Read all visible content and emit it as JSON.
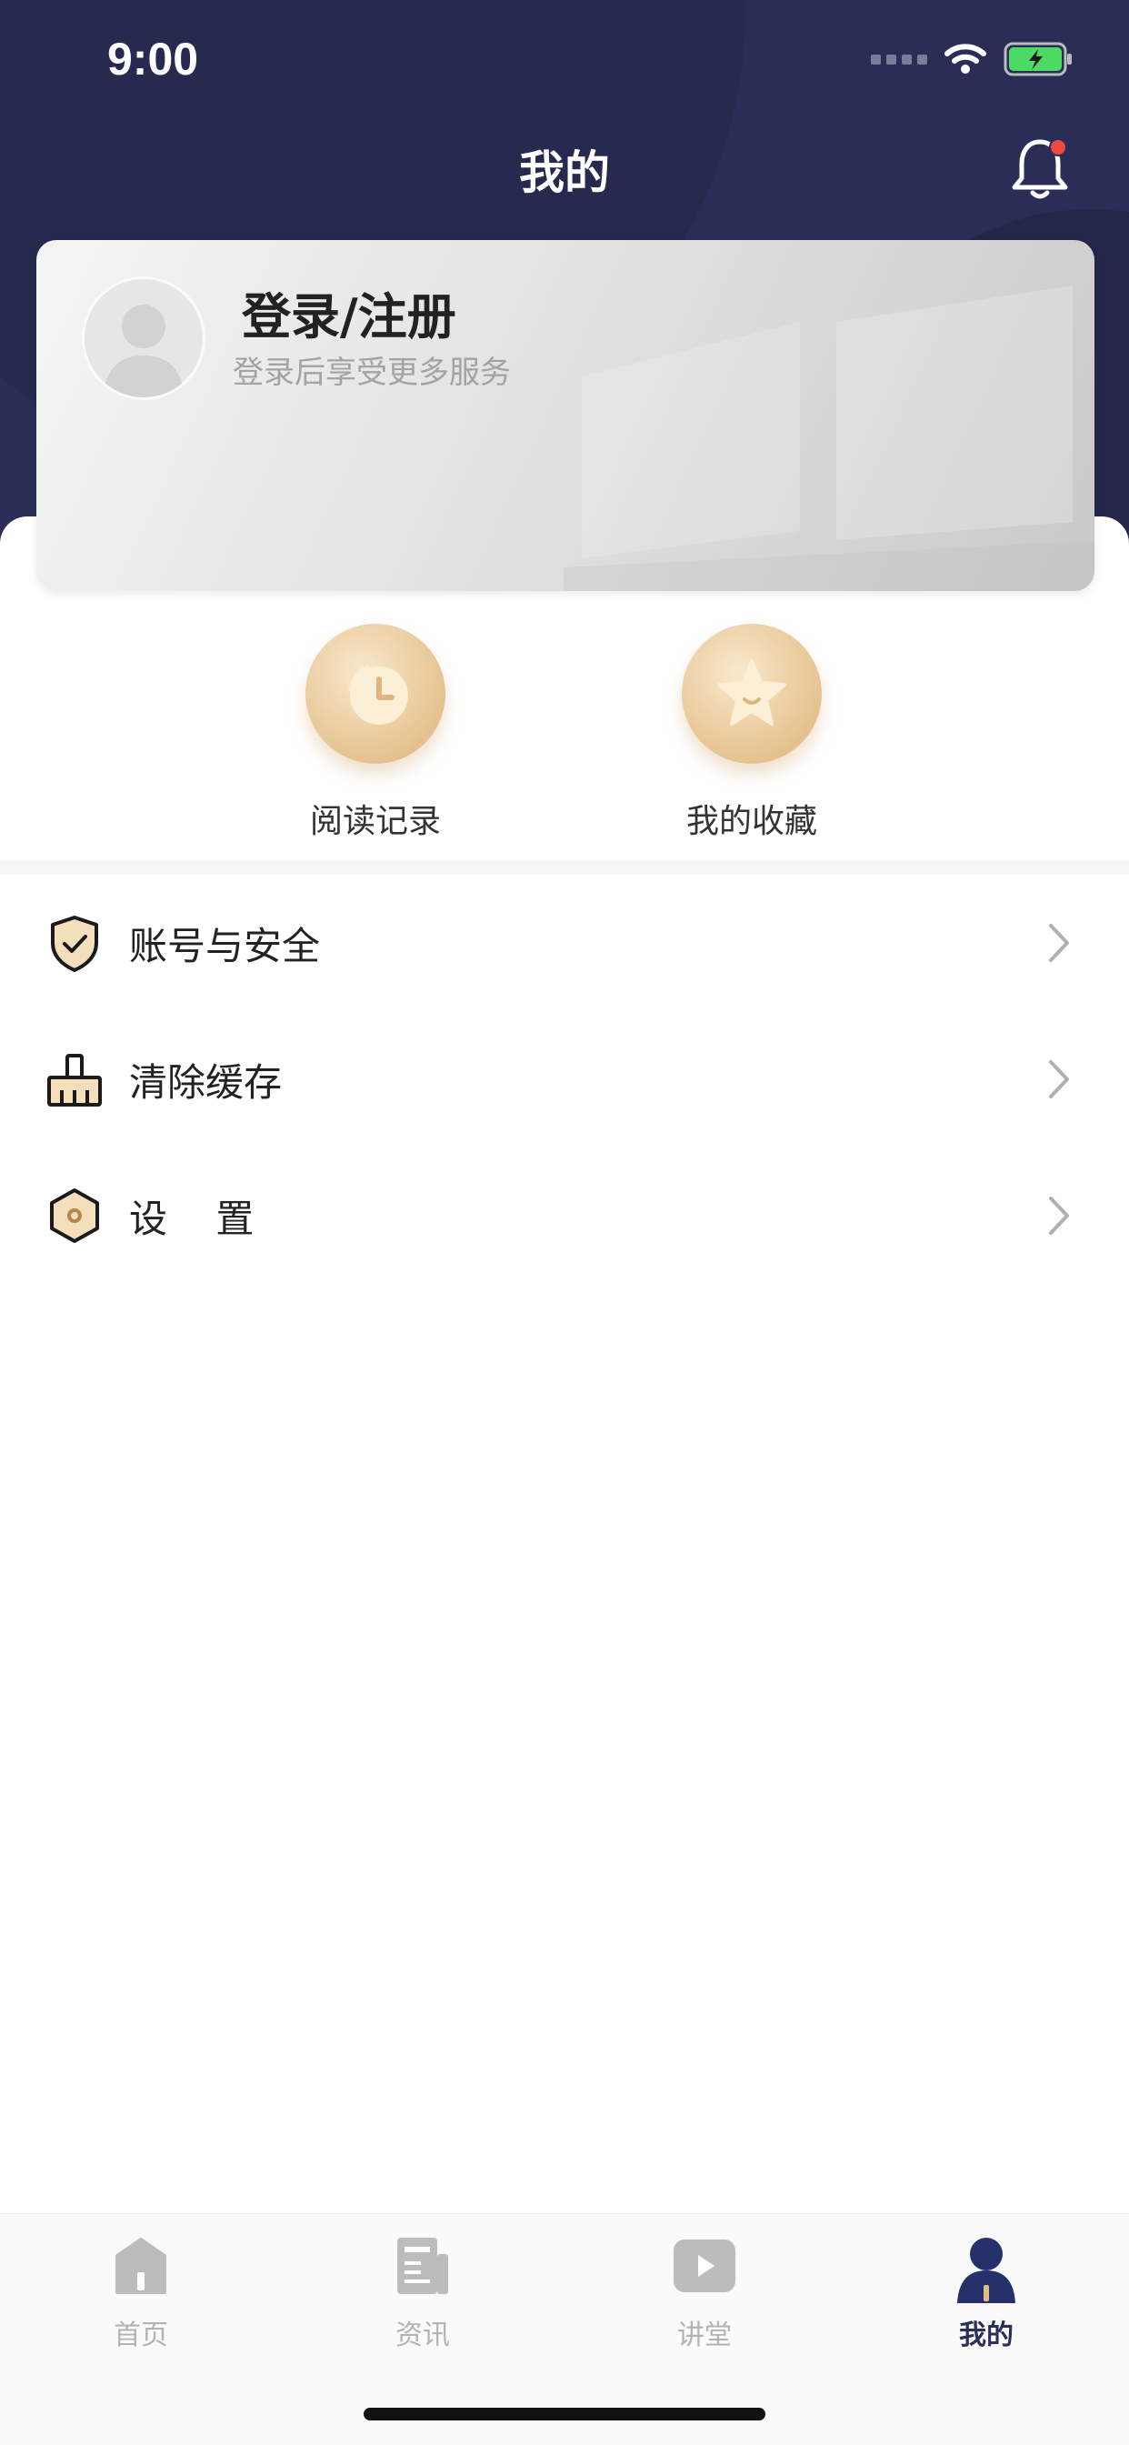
{
  "status_bar": {
    "time": "9:00"
  },
  "header": {
    "title": "我的"
  },
  "profile": {
    "login_title": "登录/注册",
    "login_subtitle": "登录后享受更多服务"
  },
  "quick_actions": [
    {
      "label": "阅读记录",
      "icon": "clock-icon"
    },
    {
      "label": "我的收藏",
      "icon": "star-icon"
    }
  ],
  "menu": [
    {
      "label": "账号与安全",
      "icon": "shield-check-icon"
    },
    {
      "label": "清除缓存",
      "icon": "broom-icon"
    },
    {
      "label": "设    置",
      "icon": "hexagon-gear-icon"
    }
  ],
  "tabbar": {
    "tabs": [
      {
        "label": "首页",
        "icon": "home-icon"
      },
      {
        "label": "资讯",
        "icon": "news-icon"
      },
      {
        "label": "讲堂",
        "icon": "play-icon"
      },
      {
        "label": "我的",
        "icon": "person-icon"
      }
    ],
    "active": "我的"
  },
  "colors": {
    "header_bg": "#2a2e57",
    "accent_gold": "#e3bd88",
    "active_tab": "#2a2f58",
    "notification_dot": "#f04a3e"
  }
}
